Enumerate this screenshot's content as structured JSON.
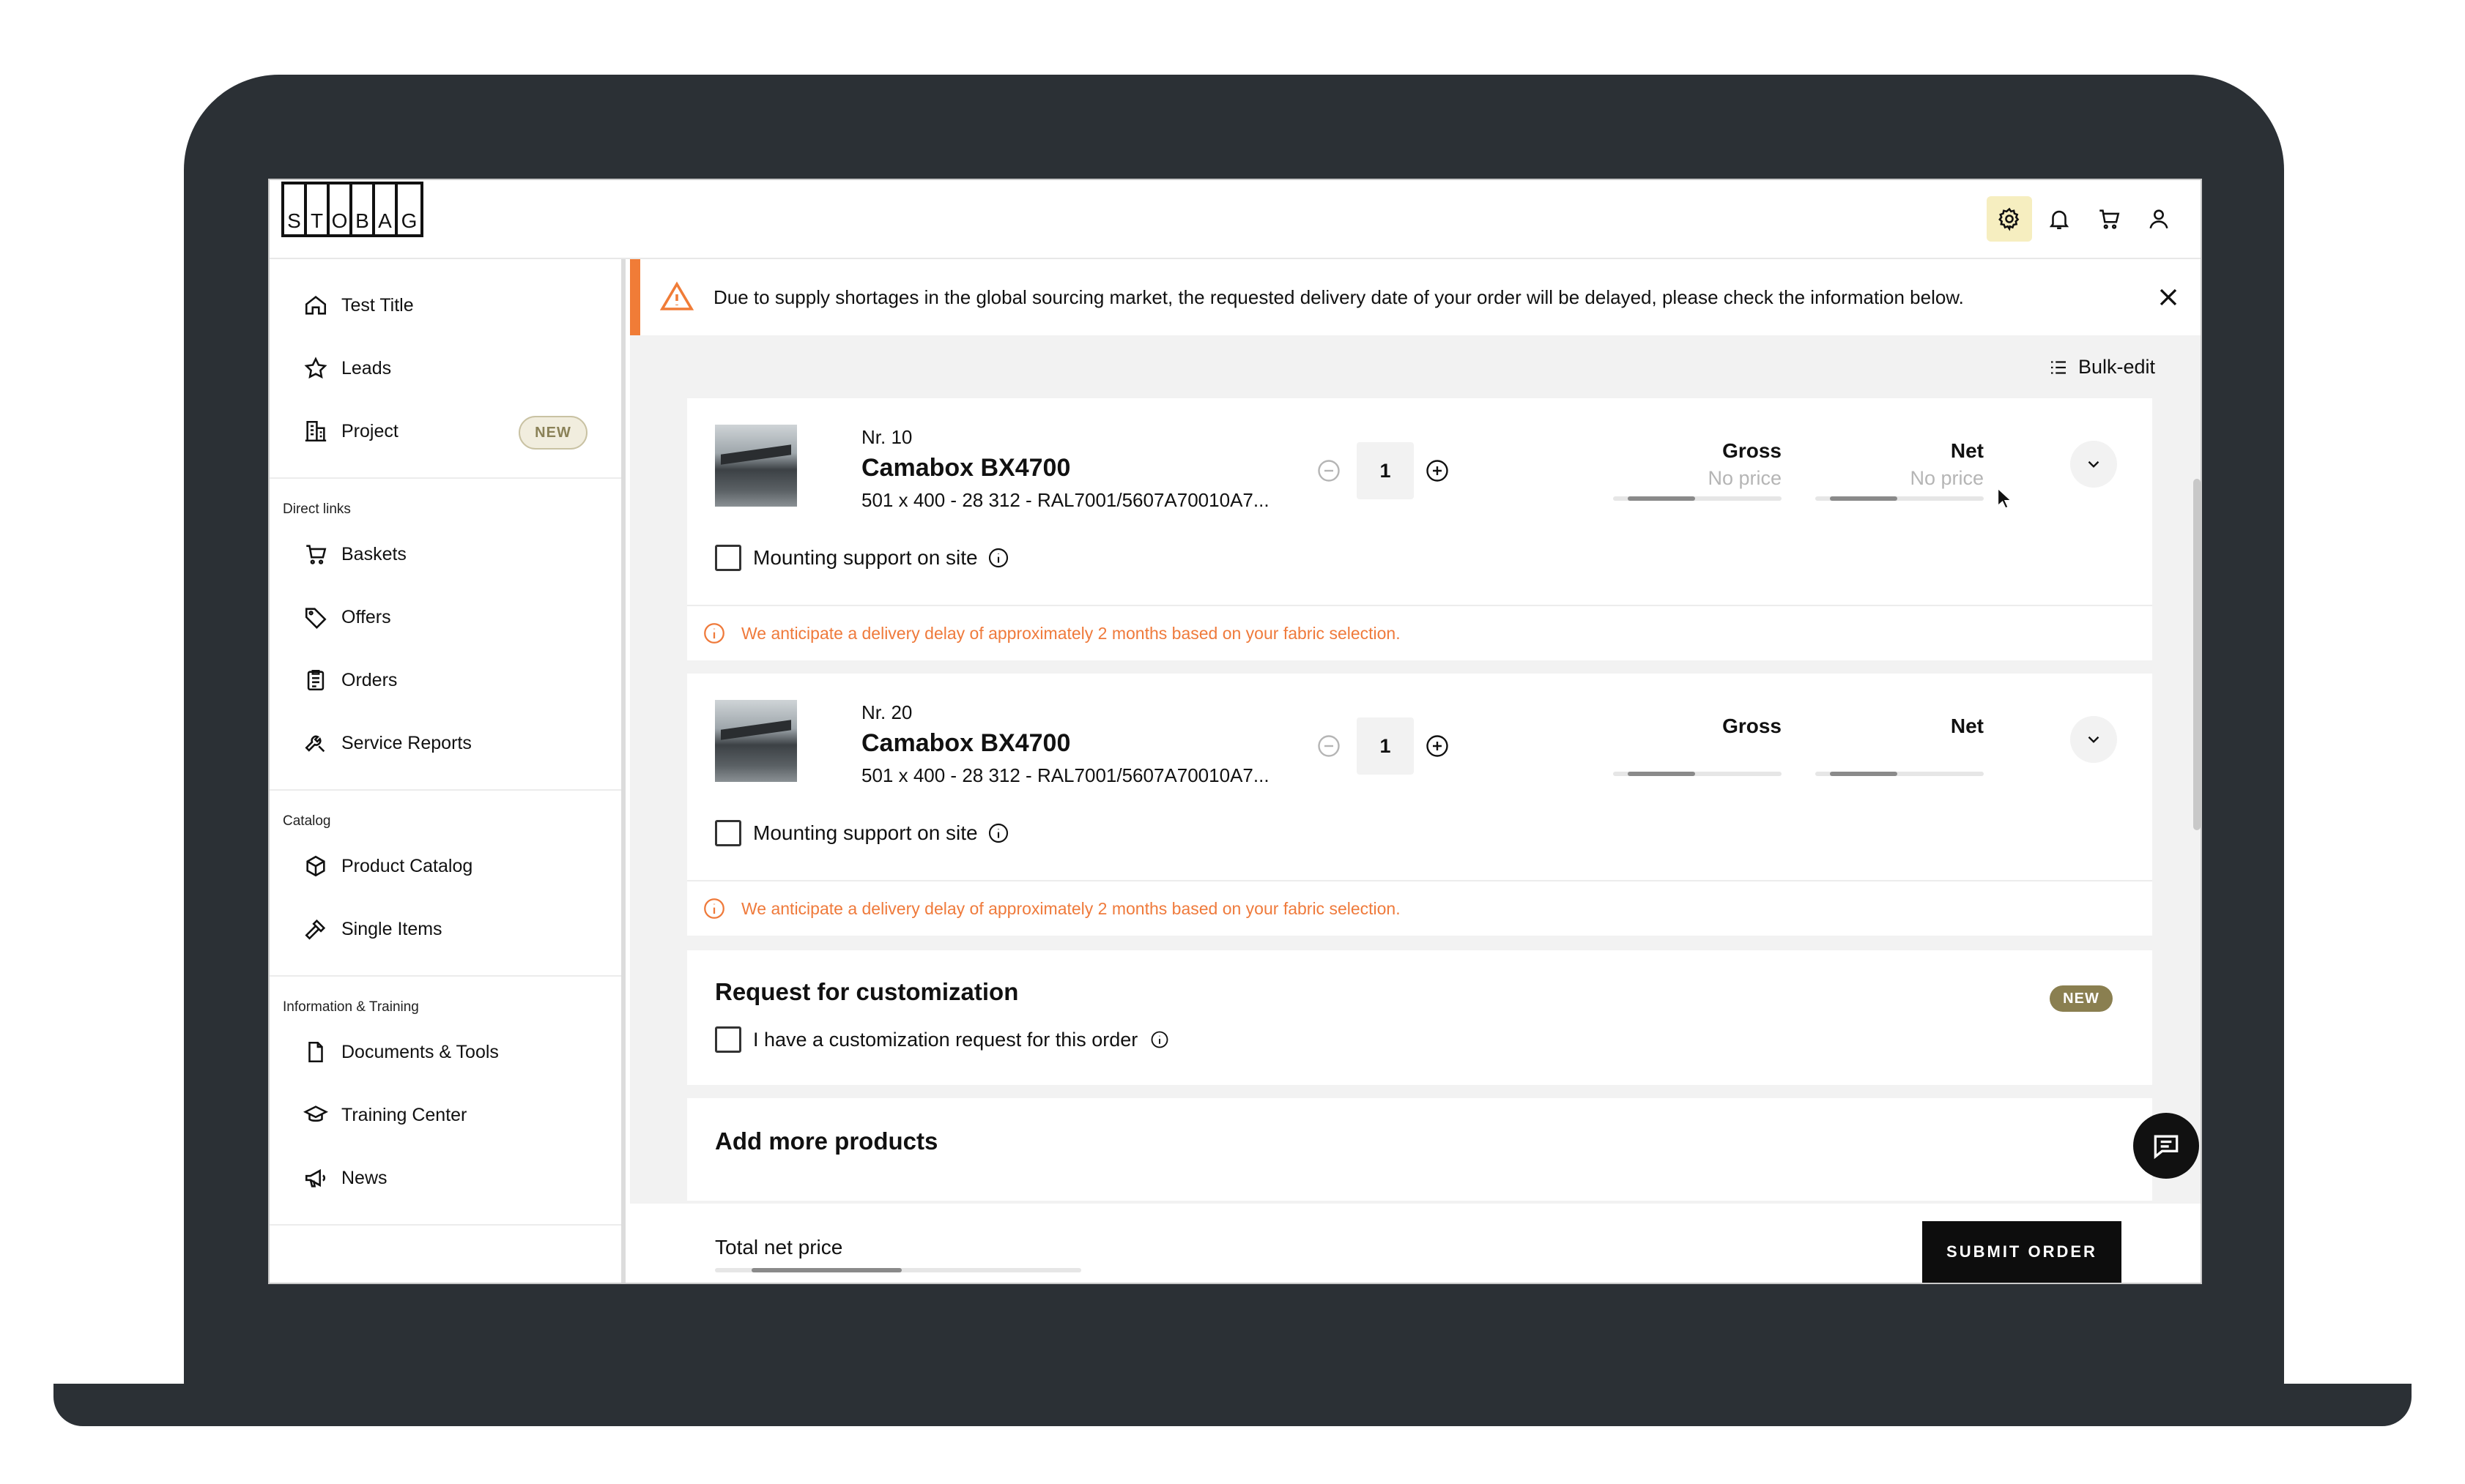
{
  "header": {
    "logo_letters": [
      "S",
      "T",
      "O",
      "B",
      "A",
      "G"
    ],
    "icons": [
      "settings-icon",
      "bell-icon",
      "cart-icon",
      "user-icon"
    ]
  },
  "sidebar": {
    "main_items": [
      {
        "label": "Test Title",
        "icon": "home-icon"
      },
      {
        "label": "Leads",
        "icon": "star-icon"
      },
      {
        "label": "Project",
        "icon": "building-icon",
        "badge": "NEW"
      }
    ],
    "direct_links_label": "Direct links",
    "direct_links": [
      {
        "label": "Baskets",
        "icon": "cart-icon"
      },
      {
        "label": "Offers",
        "icon": "tag-icon"
      },
      {
        "label": "Orders",
        "icon": "clipboard-icon"
      },
      {
        "label": "Service Reports",
        "icon": "wrench-icon"
      }
    ],
    "catalog_label": "Catalog",
    "catalog": [
      {
        "label": "Product Catalog",
        "icon": "box-icon"
      },
      {
        "label": "Single Items",
        "icon": "hammer-icon"
      }
    ],
    "info_label": "Information & Training",
    "info": [
      {
        "label": "Documents & Tools",
        "icon": "document-icon"
      },
      {
        "label": "Training Center",
        "icon": "graduation-cap-icon"
      },
      {
        "label": "News",
        "icon": "megaphone-icon"
      }
    ]
  },
  "alert": {
    "text": "Due to supply shortages in the global sourcing market, the requested delivery date of your order will be delayed, please check the information below."
  },
  "bulk_edit": "Bulk-edit",
  "products": [
    {
      "nr": "Nr. 10",
      "name": "Camabox BX4700",
      "spec": "501 x 400 - 28 312 - RAL7001/5607A70010A7...",
      "quantity": "1",
      "gross_label": "Gross",
      "gross_value": "No price",
      "net_label": "Net",
      "net_value": "No price",
      "checkbox_label": "Mounting support on site",
      "delay_note": "We anticipate a delivery delay of approximately 2 months based on your fabric selection."
    },
    {
      "nr": "Nr. 20",
      "name": "Camabox BX4700",
      "spec": "501 x 400 - 28 312 - RAL7001/5607A70010A7...",
      "quantity": "1",
      "gross_label": "Gross",
      "gross_value": "",
      "net_label": "Net",
      "net_value": "",
      "checkbox_label": "Mounting support on site",
      "delay_note": "We anticipate a delivery delay of approximately 2 months based on your fabric selection."
    }
  ],
  "customization": {
    "title": "Request for customization",
    "badge": "NEW",
    "checkbox_label": "I have a customization request for this order"
  },
  "add_products": {
    "title": "Add more products"
  },
  "footer": {
    "total_label": "Total net price",
    "submit_label": "SUBMIT ORDER"
  },
  "colors": {
    "accent_orange": "#f07c37",
    "badge_olive": "#8a7f50",
    "frame": "#2b3035",
    "button_black": "#0d0d0d"
  }
}
